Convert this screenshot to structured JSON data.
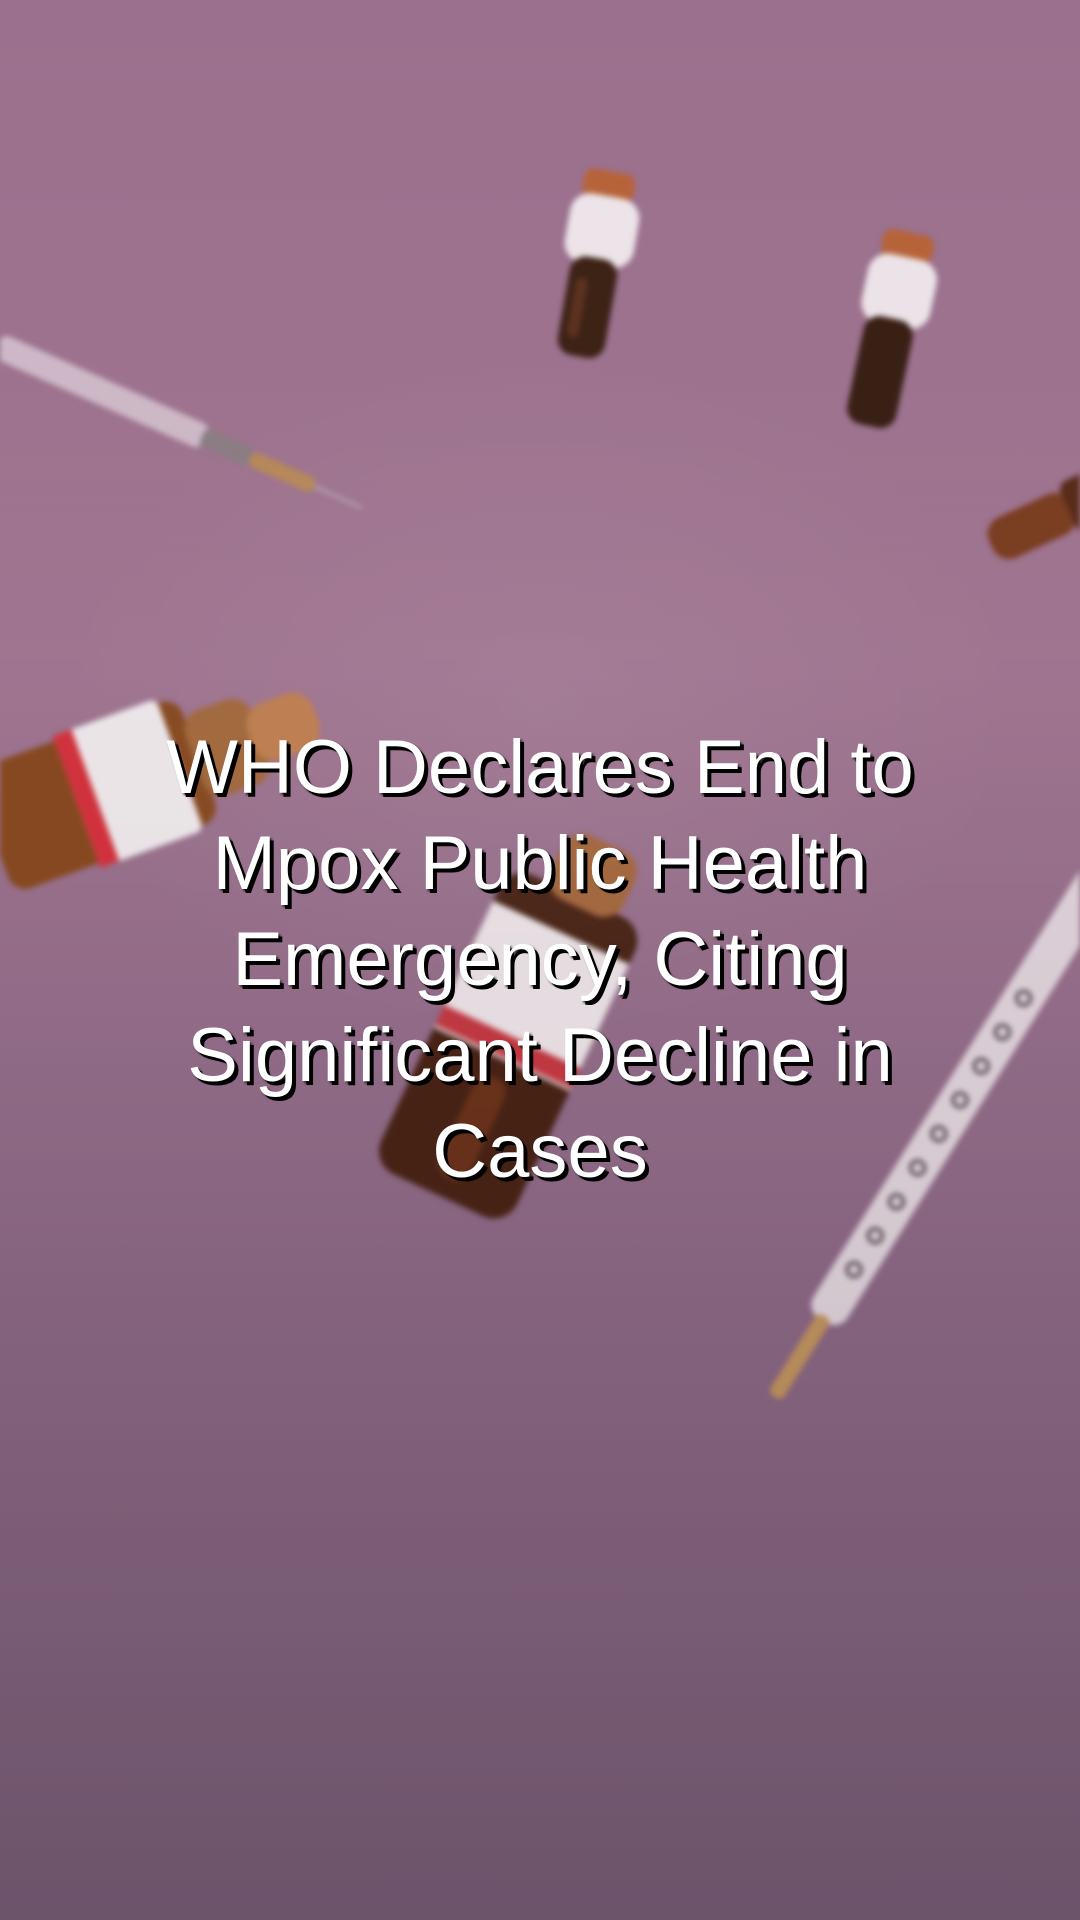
{
  "background": {
    "description_icon": "vaccine-vials-syringes-photo",
    "tint_color": "#9a708e"
  },
  "headline": {
    "text": "WHO Declares End to Mpox Public Health Emergency, Citing Significant Decline in Cases"
  }
}
